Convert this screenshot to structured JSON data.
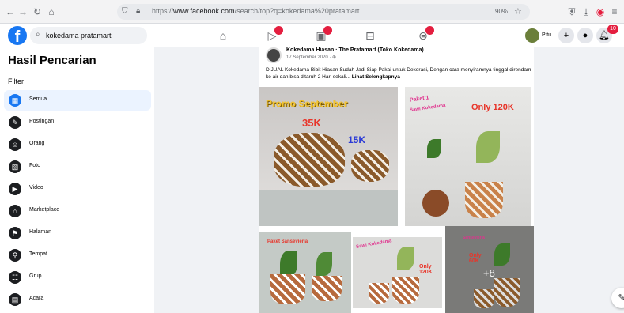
{
  "browser": {
    "url_host": "www.facebook.com",
    "url_rest": "/search/top?q=kokedama%20pratamart",
    "url_prefix": "https://",
    "zoom": "90%"
  },
  "header": {
    "search_value": "kokedama pratamart",
    "user_name": "Pitu",
    "notif_count": "10"
  },
  "sidebar": {
    "title": "Hasil Pencarian",
    "filter_label": "Filter",
    "items": [
      {
        "label": "Semua",
        "icon": "grid-icon"
      },
      {
        "label": "Postingan",
        "icon": "post-icon"
      },
      {
        "label": "Orang",
        "icon": "people-icon"
      },
      {
        "label": "Foto",
        "icon": "photo-icon"
      },
      {
        "label": "Video",
        "icon": "video-icon"
      },
      {
        "label": "Marketplace",
        "icon": "shop-icon"
      },
      {
        "label": "Halaman",
        "icon": "flag-icon"
      },
      {
        "label": "Tempat",
        "icon": "pin-icon"
      },
      {
        "label": "Grup",
        "icon": "group-icon"
      },
      {
        "label": "Acara",
        "icon": "calendar-icon"
      }
    ]
  },
  "post": {
    "page_name": "Kokedama Hiasan · The Pratamart (Toko Kokedama)",
    "date": "17 September 2020 · ⊕",
    "text": "DIJUAL Kokedama Bibit Hiasan Sudah Jadi Siap Pakai untuk Dekorasi, Dengan cara menyiramnya tinggal direndam ke air dan bisa ditaruh 2 Hari sekali...",
    "more": "Lihat Selengkapnya",
    "photos": {
      "p1_title": "Promo September",
      "p1_price_a": "35K",
      "p1_price_b": "15K",
      "p2_pack": "Paket 1",
      "p2_sub": "Sawi Kokedama",
      "p2_price": "Only 120K",
      "p3_label": "Paket Sansevieria",
      "p4_label": "Sawi Kokedama",
      "p4_price": "Only 120K",
      "p5_label": "Sansevieria",
      "p5_price": "Only 60K",
      "more_count": "+8"
    }
  },
  "colors": {
    "brand": "#1877f2",
    "active_bg": "#ebf3ff",
    "badge": "#e41e3f"
  }
}
